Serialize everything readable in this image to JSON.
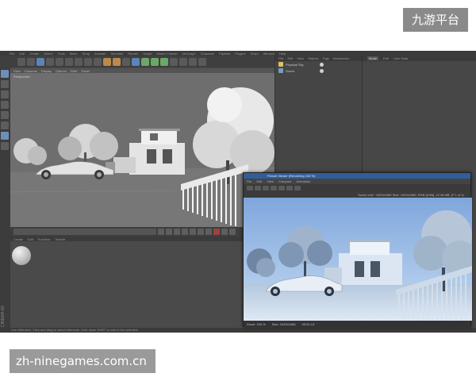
{
  "watermarks": {
    "top": "九游平台",
    "bottom": "zh-ninegames.com.cn"
  },
  "app": {
    "menu": [
      "File",
      "Edit",
      "Create",
      "Select",
      "Tools",
      "Mesh",
      "Snap",
      "Animate",
      "Simulate",
      "Render",
      "Sculpt",
      "Motion Tracker",
      "MoGraph",
      "Character",
      "Pipeline",
      "Plugins",
      "Script",
      "Window",
      "Help"
    ],
    "viewport_menu": [
      "View",
      "Cameras",
      "Display",
      "Options",
      "Filter",
      "Panel"
    ],
    "viewport_label": "Perspective",
    "material_menu": [
      "Create",
      "Edit",
      "Function",
      "Texture"
    ],
    "objects_menu": [
      "File",
      "Edit",
      "View",
      "Objects",
      "Tags",
      "Bookmarks"
    ],
    "objects": [
      {
        "name": "Physical Sky",
        "type": "sky"
      },
      {
        "name": "Scene",
        "type": "null"
      }
    ],
    "attr_tabs": [
      "Mode",
      "Edit",
      "User Data"
    ],
    "brand": "CINEMA 4D",
    "status": "Live Selection: Click and drag to select elements. Hold down SHIFT to add to the selection"
  },
  "render_window": {
    "title": "Picture Viewer (Rendering 100 %)",
    "menu": [
      "File",
      "Edit",
      "View",
      "Compare",
      "Animation"
    ],
    "file_info": "Scene.c4d * 1920x1080 Size: 1920x1080, RGB (8 Bit), 12.38 MB, (F 1 of 1)",
    "status": [
      "Zoom: 100 %",
      "Size: 1920x1080",
      "00:01:13"
    ]
  },
  "colors": {
    "ui_dark": "#3b3b3b",
    "ui_panel": "#4a4a4a",
    "viewport_bg": "#6e6e6e",
    "title_blue": "#2f5e9a",
    "sky_top": "#7fa6dc",
    "sky_bottom": "#c4dbf2"
  }
}
